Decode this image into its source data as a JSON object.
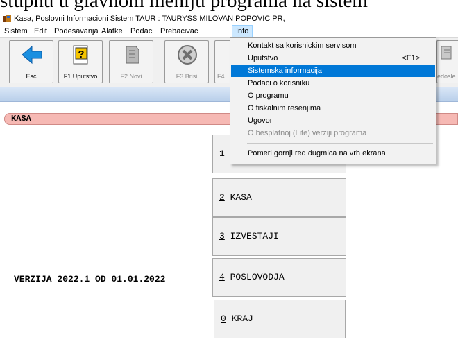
{
  "caption": "stupnu u glavnom meniju programa na sistem",
  "window": {
    "title": "Kasa, Poslovni Informacioni Sistem TAUR : TAURYSS MILOVAN POPOVIC PR,"
  },
  "menubar": [
    "Sistem",
    "Edit",
    "Podesavanja",
    "Alatke",
    "Podaci",
    "Prebacivac",
    "Info"
  ],
  "toolbar": {
    "buttons": [
      {
        "label": "Esc",
        "icon": "back-arrow-icon",
        "enabled": true
      },
      {
        "label": "F1 Uputstvo",
        "icon": "help-document-icon",
        "enabled": true
      },
      {
        "label": "F2 Novi",
        "icon": "new-document-icon",
        "enabled": false
      },
      {
        "label": "F3 Brisi",
        "icon": "delete-x-icon",
        "enabled": false
      },
      {
        "label": "F4",
        "icon": "partial-icon",
        "enabled": false
      },
      {
        "label": "edosle",
        "icon": "sort-icon",
        "enabled": false
      }
    ]
  },
  "section_title": "KASA",
  "info_menu": {
    "items": [
      {
        "label": "Kontakt sa korisnickim servisom",
        "shortcut": ""
      },
      {
        "label": "Uputstvo",
        "shortcut": "<F1>"
      },
      {
        "label": "Sistemska informacija",
        "shortcut": "",
        "highlighted": true
      },
      {
        "label": "Podaci o korisniku",
        "shortcut": ""
      },
      {
        "label": "O programu",
        "shortcut": ""
      },
      {
        "label": "O fiskalnim resenjima",
        "shortcut": ""
      },
      {
        "label": "Ugovor",
        "shortcut": ""
      },
      {
        "label": "O besplatnoj (Lite) verziji programa",
        "shortcut": "",
        "disabled": true
      },
      {
        "label": "Pomeri gornji red dugmica na vrh ekrana",
        "shortcut": ""
      }
    ]
  },
  "main_menu": {
    "buttons": [
      {
        "key": "1",
        "label": ""
      },
      {
        "key": "2",
        "label": " KASA"
      },
      {
        "key": "3",
        "label": " IZVESTAJI"
      },
      {
        "key": "4",
        "label": " POSLOVODJA"
      },
      {
        "key": "0",
        "label": " KRAJ"
      }
    ]
  },
  "version_text": "VERZIJA 2022.1 OD 01.01.2022",
  "colors": {
    "highlight": "#0078d7",
    "kasa_bar": "#f6b9b4",
    "blue_bar": "#c8daf0"
  }
}
